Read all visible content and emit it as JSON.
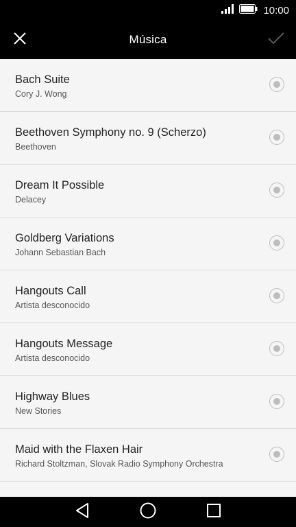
{
  "status_bar": {
    "time": "10:00",
    "signal_icon": "signal-bars-icon",
    "battery_icon": "battery-full-icon"
  },
  "app_bar": {
    "title": "Música",
    "close_icon": "close-icon",
    "confirm_icon": "check-icon"
  },
  "tracks": [
    {
      "title": "Bach Suite",
      "artist": "Cory J. Wong"
    },
    {
      "title": "Beethoven Symphony no. 9 (Scherzo)",
      "artist": "Beethoven"
    },
    {
      "title": "Dream It Possible",
      "artist": "Delacey"
    },
    {
      "title": "Goldberg Variations",
      "artist": "Johann Sebastian Bach"
    },
    {
      "title": "Hangouts Call",
      "artist": "Artista desconocido"
    },
    {
      "title": "Hangouts Message",
      "artist": "Artista desconocido"
    },
    {
      "title": "Highway Blues",
      "artist": "New Stories"
    },
    {
      "title": "Maid with the Flaxen Hair",
      "artist": "Richard Stoltzman, Slovak Radio Symphony Orchestra"
    },
    {
      "title": "",
      "artist": ""
    }
  ],
  "nav_bar": {
    "back_icon": "back-triangle-icon",
    "home_icon": "home-circle-icon",
    "recents_icon": "recents-square-icon"
  },
  "colors": {
    "bar_background": "#000000",
    "list_background": "#f5f5f5",
    "divider": "#dcdcdc",
    "radio": "#bdbdbd"
  }
}
